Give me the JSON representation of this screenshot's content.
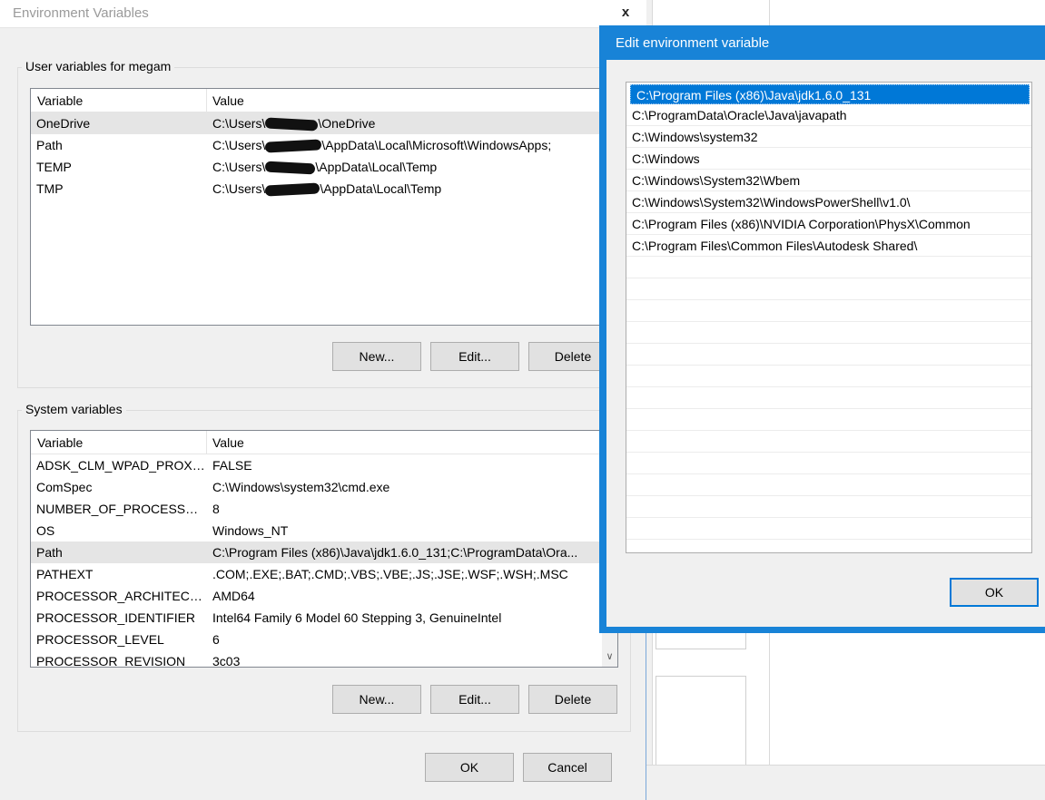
{
  "env_dialog": {
    "title": "Environment Variables",
    "close_glyph": "x",
    "user_group": {
      "label": "User variables for megam",
      "columns": [
        "Variable",
        "Value"
      ],
      "rows": [
        {
          "variable": "OneDrive",
          "value_prefix": "C:\\Users\\",
          "value_suffix": "\\OneDrive",
          "selected": true
        },
        {
          "variable": "Path",
          "value_prefix": "C:\\Users\\",
          "value_suffix": "\\AppData\\Local\\Microsoft\\WindowsApps;",
          "selected": false
        },
        {
          "variable": "TEMP",
          "value_prefix": "C:\\Users\\",
          "value_suffix": "\\AppData\\Local\\Temp",
          "selected": false
        },
        {
          "variable": "TMP",
          "value_prefix": "C:\\Users\\",
          "value_suffix": "\\AppData\\Local\\Temp",
          "selected": false
        }
      ],
      "buttons": {
        "new": "New...",
        "edit": "Edit...",
        "delete": "Delete"
      }
    },
    "system_group": {
      "label": "System variables",
      "columns": [
        "Variable",
        "Value"
      ],
      "rows": [
        {
          "variable": "ADSK_CLM_WPAD_PROXY...",
          "value": "FALSE"
        },
        {
          "variable": "ComSpec",
          "value": "C:\\Windows\\system32\\cmd.exe"
        },
        {
          "variable": "NUMBER_OF_PROCESSORS",
          "value": "8"
        },
        {
          "variable": "OS",
          "value": "Windows_NT"
        },
        {
          "variable": "Path",
          "value": "C:\\Program Files (x86)\\Java\\jdk1.6.0_131;C:\\ProgramData\\Ora..."
        },
        {
          "variable": "PATHEXT",
          "value": ".COM;.EXE;.BAT;.CMD;.VBS;.VBE;.JS;.JSE;.WSF;.WSH;.MSC"
        },
        {
          "variable": "PROCESSOR_ARCHITECTU...",
          "value": "AMD64"
        },
        {
          "variable": "PROCESSOR_IDENTIFIER",
          "value": "Intel64 Family 6 Model 60 Stepping 3, GenuineIntel"
        },
        {
          "variable": "PROCESSOR_LEVEL",
          "value": "6"
        },
        {
          "variable": "PROCESSOR_REVISION",
          "value": "3c03"
        }
      ],
      "buttons": {
        "new": "New...",
        "edit": "Edit...",
        "delete": "Delete"
      }
    },
    "footer": {
      "ok": "OK",
      "cancel": "Cancel"
    }
  },
  "edit_dialog": {
    "title": "Edit environment variable",
    "entries": [
      "C:\\Program Files (x86)\\Java\\jdk1.6.0_131",
      "C:\\ProgramData\\Oracle\\Java\\javapath",
      "C:\\Windows\\system32",
      "C:\\Windows",
      "C:\\Windows\\System32\\Wbem",
      "C:\\Windows\\System32\\WindowsPowerShell\\v1.0\\",
      "C:\\Program Files (x86)\\NVIDIA Corporation\\PhysX\\Common",
      "C:\\Program Files\\Common Files\\Autodesk Shared\\"
    ],
    "ok": "OK"
  },
  "colors": {
    "accent": "#1883d7",
    "selection": "#0078d7",
    "row_highlight": "#e5e5e5"
  }
}
